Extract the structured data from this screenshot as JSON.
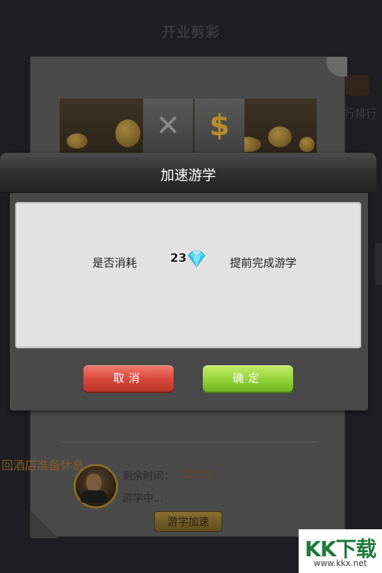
{
  "background": {
    "title": "开业剪彩",
    "right_label": "行排行",
    "hotel_text": "回酒店准备休息",
    "remaining_label": "剩余时间：",
    "remaining_value": "22:57",
    "status_text": "游学中...",
    "speedup_button_label": "游学加速"
  },
  "dialog": {
    "title": "加速游学",
    "message_prefix": "是否消耗",
    "cost": "23",
    "currency_icon": "diamond-icon",
    "message_suffix": "提前完成游学",
    "cancel_label": "取消",
    "confirm_label": "确定"
  },
  "watermark": {
    "logo": "KK下载",
    "url": "www.kkx.net"
  },
  "colors": {
    "cancel": "#d8473a",
    "confirm": "#93d33a",
    "diamond": "#5fd6f0",
    "watermark_green": "#1f7a38"
  }
}
